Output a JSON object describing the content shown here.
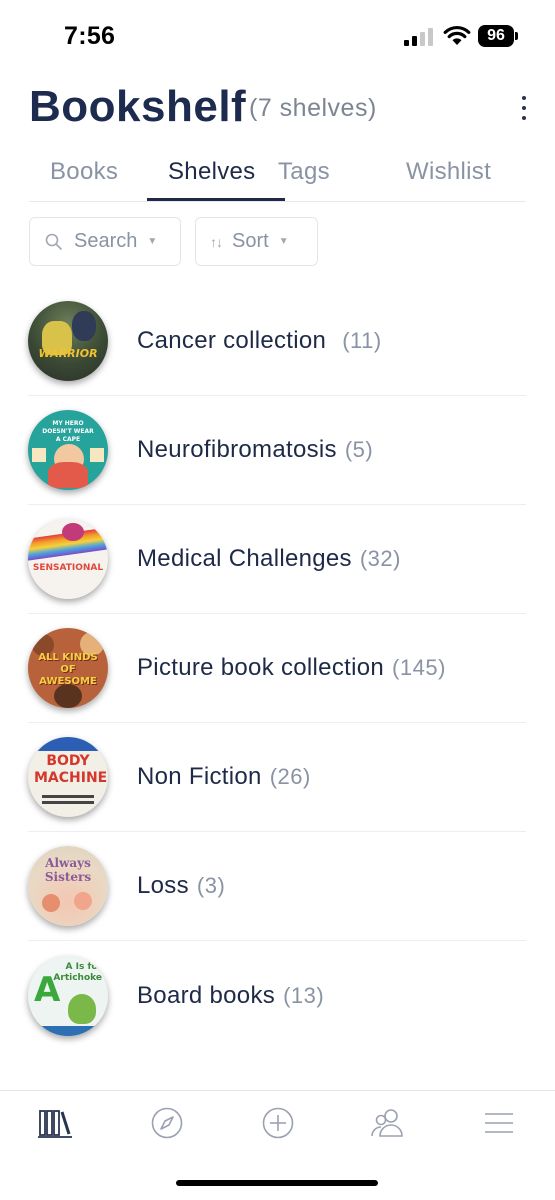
{
  "status": {
    "time": "7:56",
    "battery": "96"
  },
  "header": {
    "title": "Bookshelf",
    "shelf_count": "(7 shelves)"
  },
  "tabs": [
    {
      "label": "Books",
      "active": false
    },
    {
      "label": "Shelves",
      "active": true
    },
    {
      "label": "Tags",
      "active": false
    },
    {
      "label": "Wishlist",
      "active": false
    }
  ],
  "filters": {
    "search_label": "Search",
    "sort_label": "Sort"
  },
  "shelves": [
    {
      "name": "Cancer collection",
      "count": "(11)",
      "cover_text": "WARRIOR"
    },
    {
      "name": "Neurofibromatosis",
      "count": "(5)",
      "cover_text": "MY HERO DOESN'T WEAR A CAPE"
    },
    {
      "name": "Medical Challenges",
      "count": "(32)",
      "cover_text": "SENSATIONAL"
    },
    {
      "name": "Picture book collection",
      "count": "(145)",
      "cover_text": "ALL KINDS OF AWESOME"
    },
    {
      "name": "Non Fiction",
      "count": "(26)",
      "cover_text": "BODY MACHINE"
    },
    {
      "name": "Loss",
      "count": "(3)",
      "cover_text": "Always Sisters"
    },
    {
      "name": "Board books",
      "count": "(13)",
      "cover_text": "A Is for Artichoke"
    }
  ],
  "nav": [
    {
      "icon": "bookshelf-icon",
      "active": true
    },
    {
      "icon": "compass-icon",
      "active": false
    },
    {
      "icon": "add-circle-icon",
      "active": false
    },
    {
      "icon": "people-icon",
      "active": false
    },
    {
      "icon": "menu-icon",
      "active": false
    }
  ],
  "colors": {
    "text_primary": "#1e2a47",
    "text_muted": "#8a93a3",
    "divider": "#eceef1"
  }
}
